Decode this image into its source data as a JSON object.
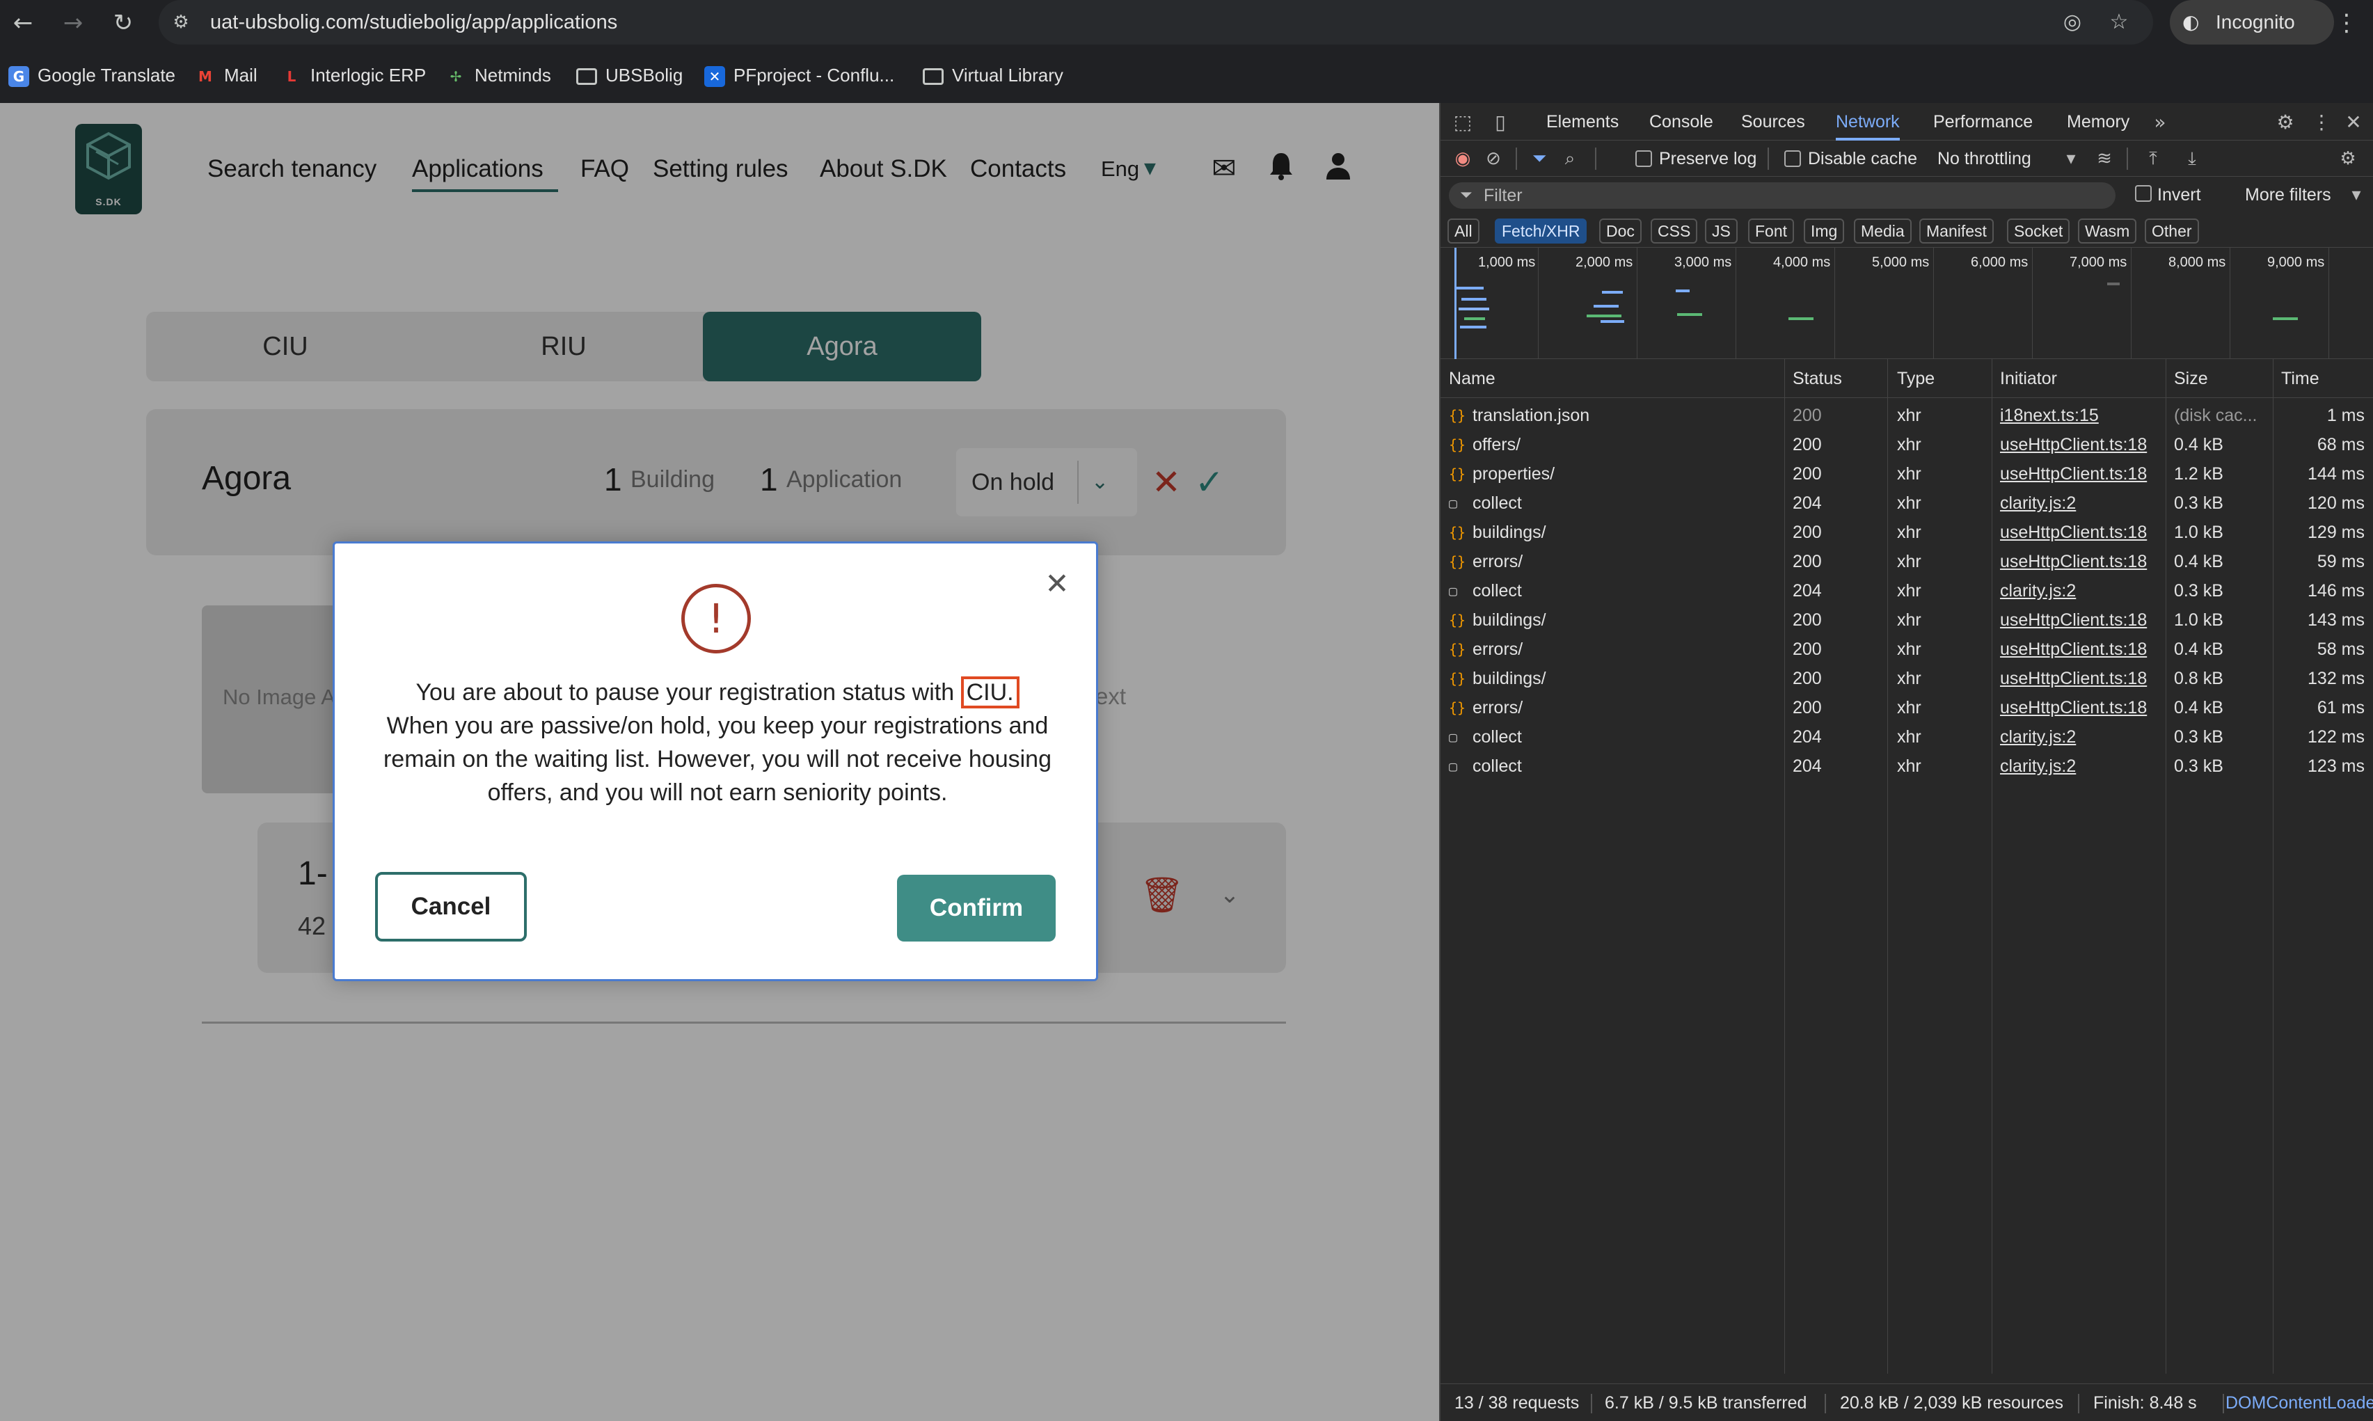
{
  "browser": {
    "url": "uat-ubsbolig.com/studiebolig/app/applications",
    "profile_label": "Incognito",
    "bookmarks": [
      "Google Translate",
      "Mail",
      "Interlogic ERP",
      "Netminds",
      "UBSBolig",
      "PFproject - Conflu...",
      "Virtual Library"
    ]
  },
  "site": {
    "logo_text": "S.DK",
    "nav": [
      "Search tenancy",
      "Applications",
      "FAQ",
      "Setting rules",
      "About S.DK",
      "Contacts"
    ],
    "active_nav": "Applications",
    "language": "Eng",
    "tabs": [
      "CIU",
      "RIU",
      "Agora"
    ],
    "active_tab": "Agora",
    "card": {
      "title": "Agora",
      "building_count": "1",
      "building_label": "Building",
      "application_count": "1",
      "application_label": "Application",
      "status_value": "On hold"
    },
    "no_image_text": "No Image A",
    "background_text": "ext",
    "row_title": "1-",
    "row_sub": "42"
  },
  "modal": {
    "message_before": "You are about to pause your registration status with ",
    "highlight": "CIU.",
    "message_after": "When you are passive/on hold, you keep your registrations and remain on the waiting list. However, you will not receive housing offers, and you will not earn seniority points.",
    "cancel_label": "Cancel",
    "confirm_label": "Confirm"
  },
  "devtools": {
    "panels": [
      "Elements",
      "Console",
      "Sources",
      "Network",
      "Performance",
      "Memory"
    ],
    "active_panel": "Network",
    "preserve_log": "Preserve log",
    "disable_cache": "Disable cache",
    "throttling": "No throttling",
    "filter_placeholder": "Filter",
    "invert_label": "Invert",
    "more_filters": "More filters",
    "type_filters": [
      "All",
      "Fetch/XHR",
      "Doc",
      "CSS",
      "JS",
      "Font",
      "Img",
      "Media",
      "Manifest",
      "Socket",
      "Wasm",
      "Other"
    ],
    "active_type": "Fetch/XHR",
    "timeline_ticks": [
      "1,000 ms",
      "2,000 ms",
      "3,000 ms",
      "4,000 ms",
      "5,000 ms",
      "6,000 ms",
      "7,000 ms",
      "8,000 ms",
      "9,000 ms"
    ],
    "columns": [
      "Name",
      "Status",
      "Type",
      "Initiator",
      "Size",
      "Time"
    ],
    "requests": [
      {
        "name": "translation.json",
        "status": "200",
        "type": "xhr",
        "initiator": "i18next.ts:15",
        "size": "(disk cac...",
        "time": "1 ms",
        "kind": "fetch"
      },
      {
        "name": "offers/",
        "status": "200",
        "type": "xhr",
        "initiator": "useHttpClient.ts:18",
        "size": "0.4 kB",
        "time": "68 ms",
        "kind": "fetch"
      },
      {
        "name": "properties/",
        "status": "200",
        "type": "xhr",
        "initiator": "useHttpClient.ts:18",
        "size": "1.2 kB",
        "time": "144 ms",
        "kind": "fetch"
      },
      {
        "name": "collect",
        "status": "204",
        "type": "xhr",
        "initiator": "clarity.js:2",
        "size": "0.3 kB",
        "time": "120 ms",
        "kind": "doc"
      },
      {
        "name": "buildings/",
        "status": "200",
        "type": "xhr",
        "initiator": "useHttpClient.ts:18",
        "size": "1.0 kB",
        "time": "129 ms",
        "kind": "fetch"
      },
      {
        "name": "errors/",
        "status": "200",
        "type": "xhr",
        "initiator": "useHttpClient.ts:18",
        "size": "0.4 kB",
        "time": "59 ms",
        "kind": "fetch"
      },
      {
        "name": "collect",
        "status": "204",
        "type": "xhr",
        "initiator": "clarity.js:2",
        "size": "0.3 kB",
        "time": "146 ms",
        "kind": "doc"
      },
      {
        "name": "buildings/",
        "status": "200",
        "type": "xhr",
        "initiator": "useHttpClient.ts:18",
        "size": "1.0 kB",
        "time": "143 ms",
        "kind": "fetch"
      },
      {
        "name": "errors/",
        "status": "200",
        "type": "xhr",
        "initiator": "useHttpClient.ts:18",
        "size": "0.4 kB",
        "time": "58 ms",
        "kind": "fetch"
      },
      {
        "name": "buildings/",
        "status": "200",
        "type": "xhr",
        "initiator": "useHttpClient.ts:18",
        "size": "0.8 kB",
        "time": "132 ms",
        "kind": "fetch"
      },
      {
        "name": "errors/",
        "status": "200",
        "type": "xhr",
        "initiator": "useHttpClient.ts:18",
        "size": "0.4 kB",
        "time": "61 ms",
        "kind": "fetch"
      },
      {
        "name": "collect",
        "status": "204",
        "type": "xhr",
        "initiator": "clarity.js:2",
        "size": "0.3 kB",
        "time": "122 ms",
        "kind": "doc"
      },
      {
        "name": "collect",
        "status": "204",
        "type": "xhr",
        "initiator": "clarity.js:2",
        "size": "0.3 kB",
        "time": "123 ms",
        "kind": "doc"
      }
    ],
    "summary": {
      "requests": "13 / 38 requests",
      "transferred": "6.7 kB / 9.5 kB transferred",
      "resources": "20.8 kB / 2,039 kB resources",
      "finish": "Finish: 8.48 s",
      "dcl": "DOMContentLoade"
    }
  },
  "colors": {
    "brand": "#2d6e6a",
    "danger": "#c0392b",
    "devtools_accent": "#7cacf8"
  }
}
